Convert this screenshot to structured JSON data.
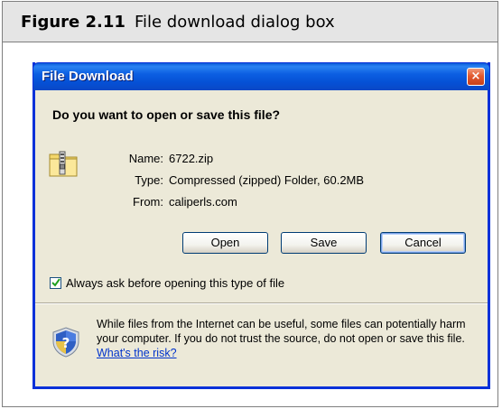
{
  "figure": {
    "number": "Figure 2.11",
    "caption": "File download dialog box"
  },
  "dialog": {
    "title": "File Download",
    "close_label": "×",
    "question": "Do you want to open or save this file?",
    "file_icon": "zip-folder-icon",
    "fields": [
      {
        "label": "Name:",
        "value": "6722.zip"
      },
      {
        "label": "Type:",
        "value": "Compressed (zipped) Folder, 60.2MB"
      },
      {
        "label": "From:",
        "value": "caliperls.com"
      }
    ],
    "buttons": {
      "open": "Open",
      "save": "Save",
      "cancel": "Cancel"
    },
    "checkbox": {
      "label": "Always ask before opening this type of file",
      "checked": true
    },
    "warning": {
      "icon": "security-shield-icon",
      "text": "While files from the Internet can be useful, some files can potentially harm your computer. If you do not trust the source, do not open or save this file.",
      "link": "What's the risk?"
    },
    "colors": {
      "titlebar": "#0a5ad8",
      "face": "#ece9d8",
      "close": "#e35a2f",
      "link": "#0033cc"
    }
  }
}
